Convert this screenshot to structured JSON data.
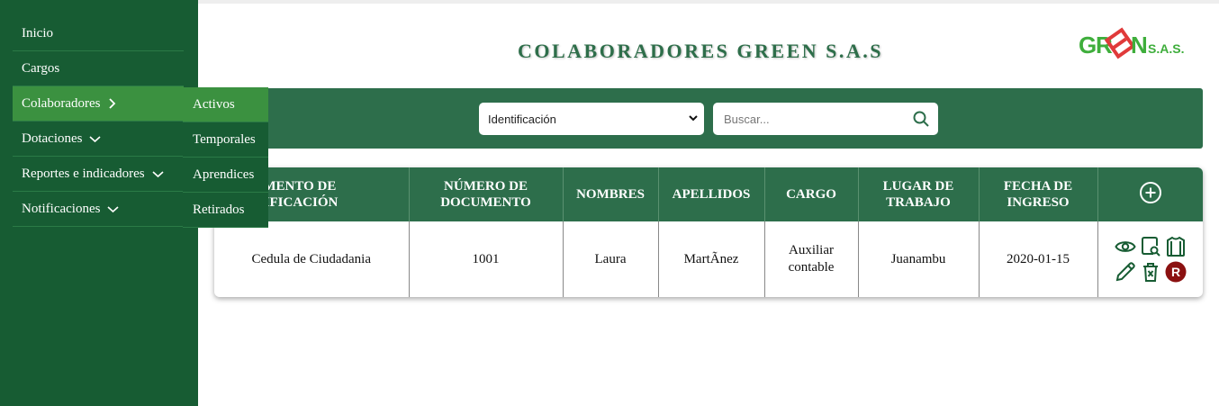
{
  "sidebar": {
    "items": [
      {
        "label": "Inicio"
      },
      {
        "label": "Cargos"
      },
      {
        "label": "Colaboradores",
        "icon": "chevron-right-icon"
      },
      {
        "label": "Dotaciones",
        "icon": "chevron-down-icon"
      },
      {
        "label": "Reportes e indicadores",
        "icon": "chevron-down-icon"
      },
      {
        "label": "Notificaciones",
        "icon": "chevron-down-icon"
      }
    ],
    "submenu": [
      "Activos",
      "Temporales",
      "Aprendices",
      "Retirados"
    ]
  },
  "header": {
    "title": "COLABORADORES GREEN S.A.S",
    "logo_text": "GREEN S.A.S."
  },
  "toolbar": {
    "filter_selected": "Identificación",
    "search_placeholder": "Buscar..."
  },
  "table": {
    "columns": [
      "DOCUMENTO DE IDENTIFICACIÓN",
      "NÚMERO DE DOCUMENTO",
      "NOMBRES",
      "APELLIDOS",
      "CARGO",
      "LUGAR DE TRABAJO",
      "FECHA DE INGRESO"
    ],
    "rows": [
      {
        "documento": "Cedula de Ciudadania",
        "numero": "1001",
        "nombres": "Laura",
        "apellidos": "MartÃnez",
        "cargo": "Auxiliar contable",
        "lugar": "Juanambu",
        "fecha": "2020-01-15"
      }
    ],
    "row_action_icons": [
      "eye-icon",
      "search-document-icon",
      "shirt-icon",
      "pencil-icon",
      "delete-icon",
      "r-badge-icon"
    ]
  },
  "colors": {
    "sidebar": "#175c33",
    "active": "#3b9140",
    "header_green": "#2d6e4b",
    "title": "#2e6e4a",
    "danger": "#8b1111"
  }
}
